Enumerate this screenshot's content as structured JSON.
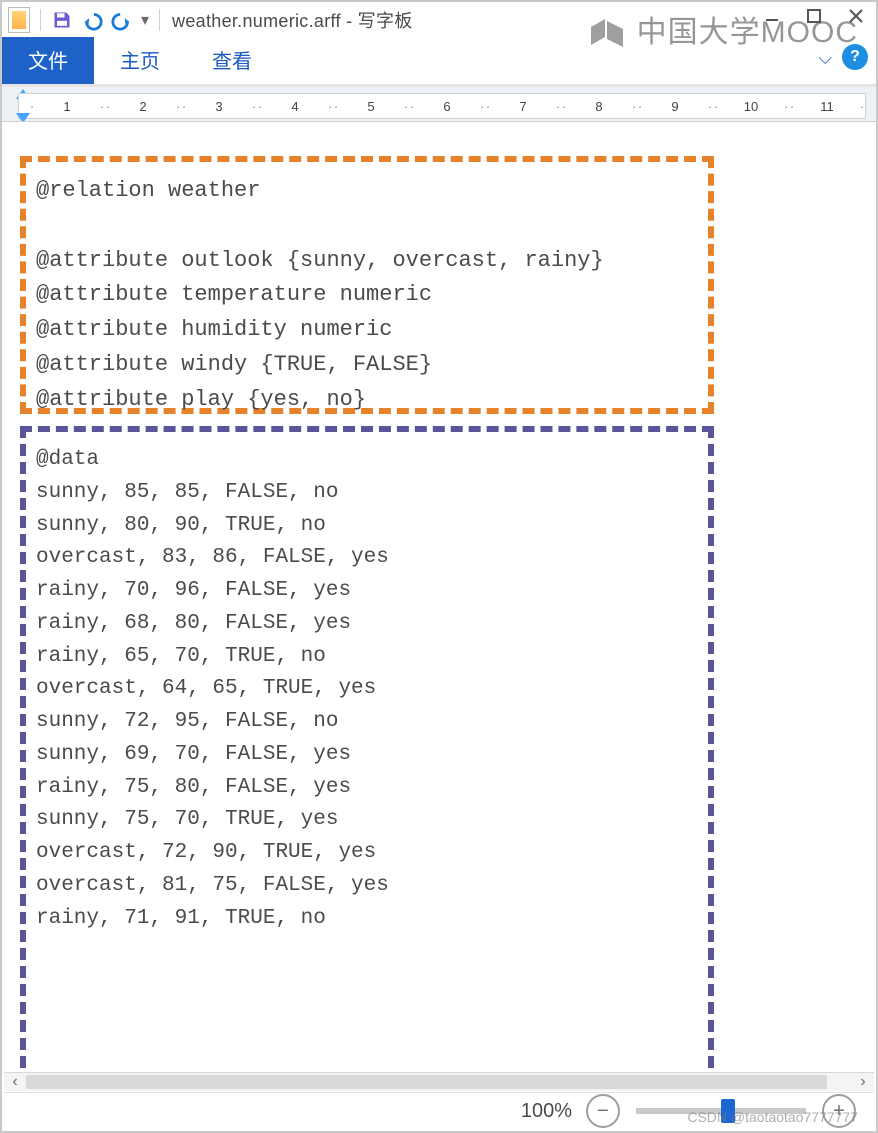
{
  "title": "weather.numeric.arff - 写字板",
  "tabs": {
    "file": "文件",
    "home": "主页",
    "view": "查看"
  },
  "ruler_numbers": [
    "1",
    "2",
    "3",
    "4",
    "5",
    "6",
    "7",
    "8",
    "9",
    "10",
    "11"
  ],
  "header_lines": [
    "@relation weather",
    "",
    "@attribute outlook {sunny, overcast, rainy}",
    "@attribute temperature numeric",
    "@attribute humidity numeric",
    "@attribute windy {TRUE, FALSE}",
    "@attribute play {yes, no}"
  ],
  "data_lines": [
    "@data",
    "sunny, 85, 85, FALSE, no",
    "sunny, 80, 90, TRUE, no",
    "overcast, 83, 86, FALSE, yes",
    "rainy, 70, 96, FALSE, yes",
    "rainy, 68, 80, FALSE, yes",
    "rainy, 65, 70, TRUE, no",
    "overcast, 64, 65, TRUE, yes",
    "sunny, 72, 95, FALSE, no",
    "sunny, 69, 70, FALSE, yes",
    "rainy, 75, 80, FALSE, yes",
    "sunny, 75, 70, TRUE, yes",
    "overcast, 72, 90, TRUE, yes",
    "overcast, 81, 75, FALSE, yes",
    "rainy, 71, 91, TRUE, no"
  ],
  "zoom": {
    "label": "100%"
  },
  "watermark": "中国大学MOOC",
  "csdn": "CSDN @taotaotao7777777"
}
